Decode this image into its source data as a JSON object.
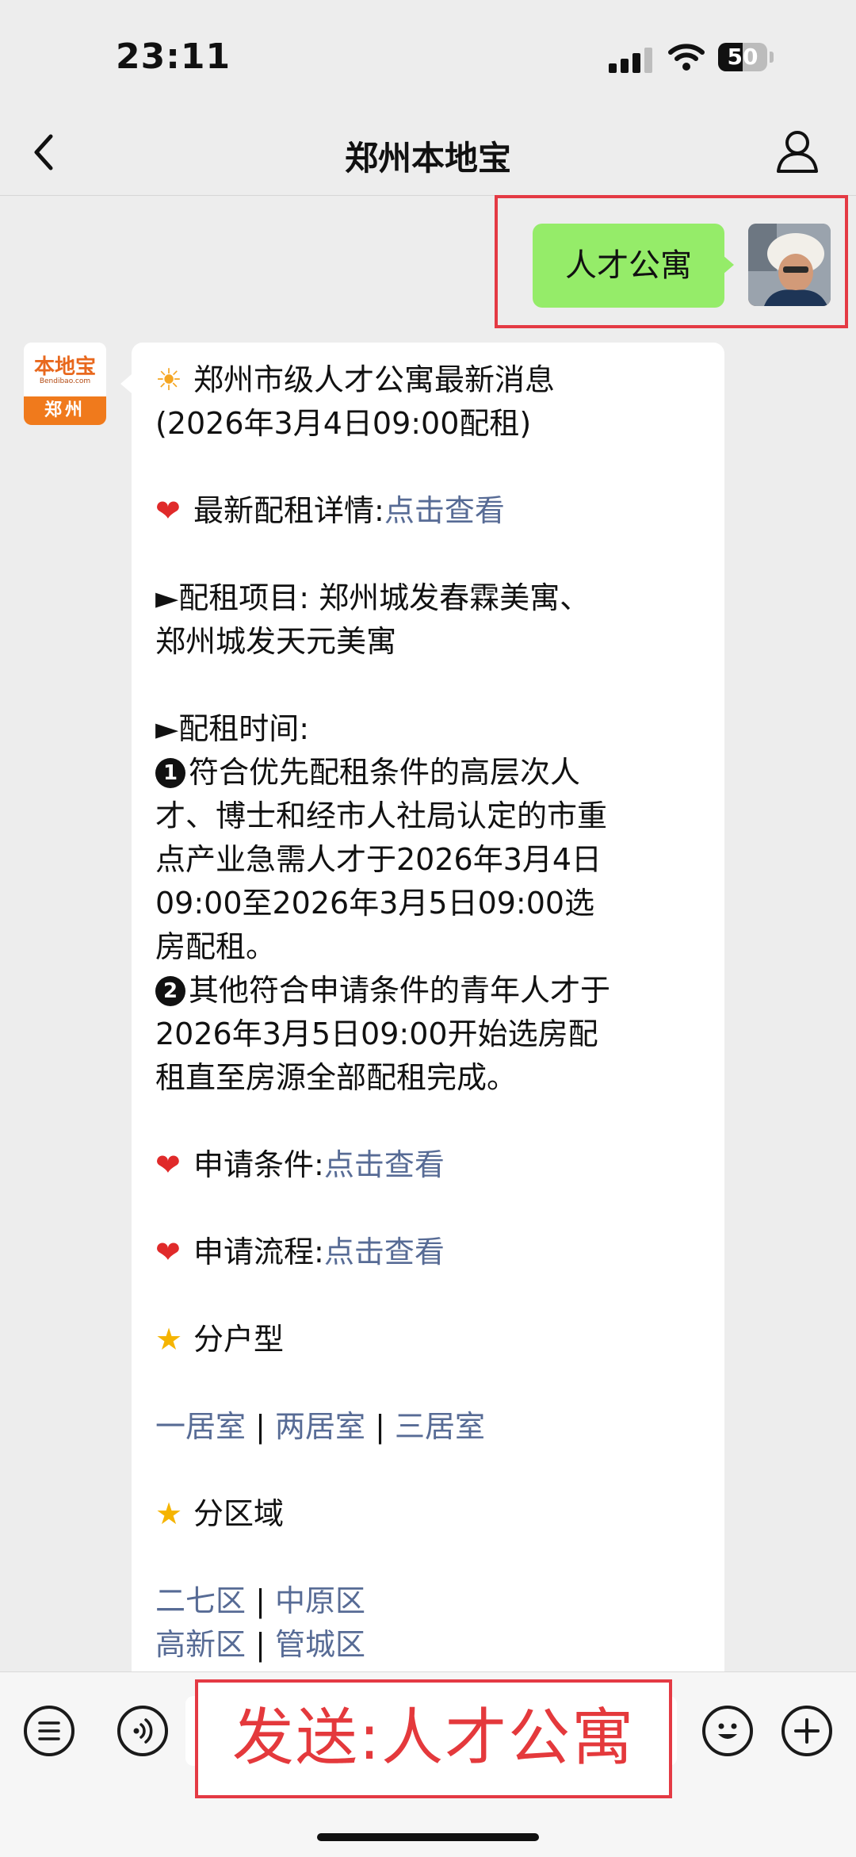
{
  "status": {
    "time": "23:11",
    "battery": "50"
  },
  "nav": {
    "title": "郑州本地宝"
  },
  "sent": {
    "text": "人才公寓"
  },
  "bot": {
    "logo": "本地宝",
    "logo_sub": "Bendibao.com",
    "city": "郑州"
  },
  "message": {
    "title1": "郑州市级人才公寓最新消息",
    "title2": "(2026年3月4日09:00配租)",
    "latest_label": "最新配租详情:",
    "latest_link": "点击查看",
    "project_line1": "►配租项目: 郑州城发春霖美寓、",
    "project_line2": "郑州城发天元美寓",
    "time_label": "►配租时间:",
    "item1_badge": "1",
    "item1_l1": "符合优先配租条件的高层次人",
    "item1_l2": "才、博士和经市人社局认定的市重",
    "item1_l3": "点产业急需人才于2026年3月4日",
    "item1_l4": "09:00至2026年3月5日09:00选",
    "item1_l5": "房配租。",
    "item2_badge": "2",
    "item2_l1": "其他符合申请条件的青年人才于",
    "item2_l2": "2026年3月5日09:00开始选房配",
    "item2_l3": "租直至房源全部配租完成。",
    "cond_label": "申请条件:",
    "cond_link": "点击查看",
    "flow_label": "申请流程:",
    "flow_link": "点击查看",
    "type_label": "分户型",
    "room1": "一居室",
    "room2": "两居室",
    "room3": "三居室",
    "sep": "|",
    "area_label": "分区域",
    "area1": "二七区",
    "area2": "中原区",
    "area3": "高新区",
    "area4": "管城区"
  },
  "input": {
    "overlay_text": "发送:人才公寓"
  },
  "icons": [
    "back-icon",
    "profile-icon",
    "menu-icon",
    "voice-icon",
    "emoji-icon",
    "plus-icon",
    "sun-icon",
    "heart-icon",
    "star-icon"
  ],
  "colors": {
    "sent_bubble": "#95ec69",
    "link": "#576b95",
    "highlight": "#e43a44"
  }
}
